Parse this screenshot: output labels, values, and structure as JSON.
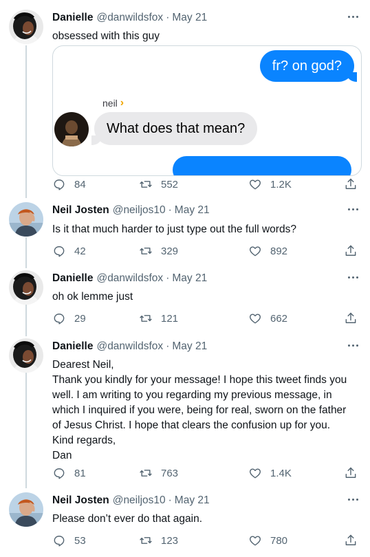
{
  "tweets": [
    {
      "name": "Danielle",
      "handle": "@danwildsfox",
      "date": "May 21",
      "text": "obsessed with this guy",
      "replies": "84",
      "retweets": "552",
      "likes": "1.2K",
      "avatar": "danielle-avatar"
    },
    {
      "name": "Neil Josten",
      "handle": "@neiljos10",
      "date": "May 21",
      "text": "Is it that much harder to just type out the full words?",
      "replies": "42",
      "retweets": "329",
      "likes": "892",
      "avatar": "neil-avatar"
    },
    {
      "name": "Danielle",
      "handle": "@danwildsfox",
      "date": "May 21",
      "text": "oh ok lemme just",
      "replies": "29",
      "retweets": "121",
      "likes": "662",
      "avatar": "danielle-avatar"
    },
    {
      "name": "Danielle",
      "handle": "@danwildsfox",
      "date": "May 21",
      "lines": [
        "Dearest Neil,",
        "Thank you kindly for your message! I hope this tweet finds you",
        "well. I am writing to you regarding my previous message, in",
        "which I inquired if you were, being for real, sworn on the father",
        "of Jesus Christ. I hope that clears the confusion up for you.",
        "Kind regards,",
        "Dan"
      ],
      "replies": "81",
      "retweets": "763",
      "likes": "1.4K",
      "avatar": "danielle-avatar"
    },
    {
      "name": "Neil Josten",
      "handle": "@neiljos10",
      "date": "May 21",
      "text": "Please don’t ever do that again.",
      "replies": "53",
      "retweets": "123",
      "likes": "780",
      "avatar": "neil-avatar"
    }
  ],
  "media": {
    "outgoing_message": "fr? on god?",
    "sender_name": "neil",
    "incoming_message": "What does that mean?"
  },
  "colors": {
    "imessage_blue": "#0a84ff",
    "imessage_gray": "#e9e9eb",
    "secondary_text": "#536471",
    "thread_line": "#cfd9de",
    "sender_chevron": "#f0a500"
  },
  "icons": [
    "reply-icon",
    "retweet-icon",
    "like-icon",
    "share-icon",
    "more-icon"
  ]
}
